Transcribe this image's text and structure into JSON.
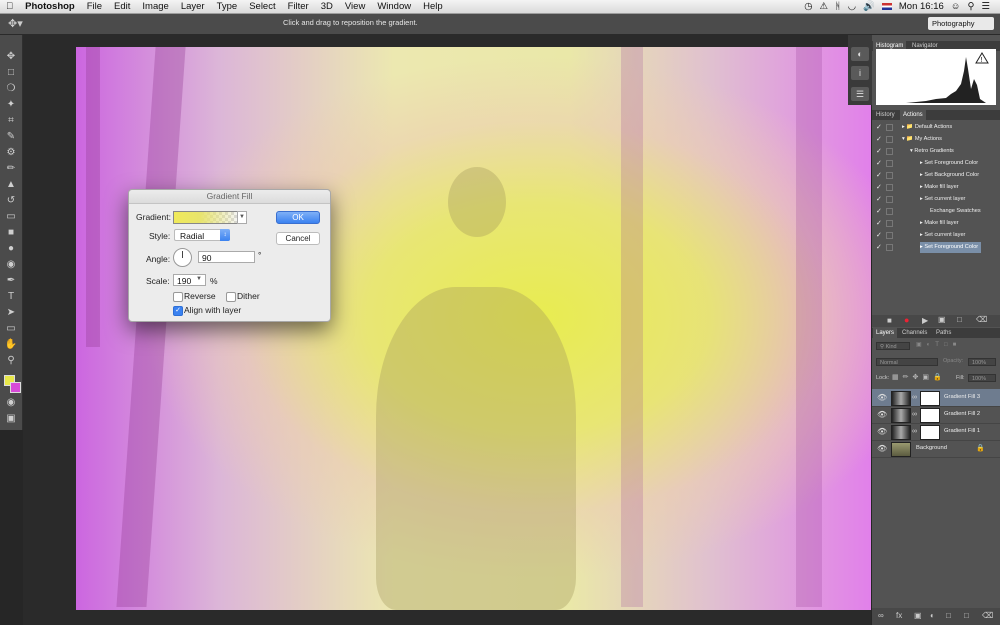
{
  "menubar": {
    "apple": "",
    "app_name": "Photoshop",
    "items": [
      "File",
      "Edit",
      "Image",
      "Layer",
      "Type",
      "Select",
      "Filter",
      "3D",
      "View",
      "Window",
      "Help"
    ],
    "clock": "Mon 16:16"
  },
  "options_bar": {
    "hint": "Click and drag to reposition the gradient.",
    "workspace": "Photography"
  },
  "dialog": {
    "title": "Gradient Fill",
    "gradient_label": "Gradient:",
    "style_label": "Style:",
    "style_value": "Radial",
    "angle_label": "Angle:",
    "angle_value": "90",
    "angle_unit": "°",
    "scale_label": "Scale:",
    "scale_value": "190",
    "scale_unit": "%",
    "reverse_label": "Reverse",
    "dither_label": "Dither",
    "align_label": "Align with layer",
    "ok_label": "OK",
    "cancel_label": "Cancel"
  },
  "histogram_panel": {
    "tabs": [
      "Histogram",
      "Navigator"
    ]
  },
  "actions_panel": {
    "tabs": [
      "History",
      "Actions"
    ],
    "items": [
      "Default Actions",
      "My Actions",
      "Retro Gradients",
      "Set Foreground Color",
      "Set Background Color",
      "Make fill layer",
      "Set current layer",
      "Exchange Swatches",
      "Make fill layer",
      "Set current layer",
      "Set Foreground Color"
    ]
  },
  "layers_panel": {
    "tabs": [
      "Layers",
      "Channels",
      "Paths"
    ],
    "kind": "Kind",
    "blend_mode": "Normal",
    "opacity_label": "Opacity:",
    "opacity_value": "100%",
    "lock_label": "Lock:",
    "fill_label": "Fill:",
    "fill_value": "100%",
    "layers": [
      "Gradient Fill 3",
      "Gradient Fill 2",
      "Gradient Fill 1",
      "Background"
    ]
  },
  "colors": {
    "foreground": "#e8e84a",
    "background": "#d84ad8",
    "accent": "#3b82f0"
  }
}
